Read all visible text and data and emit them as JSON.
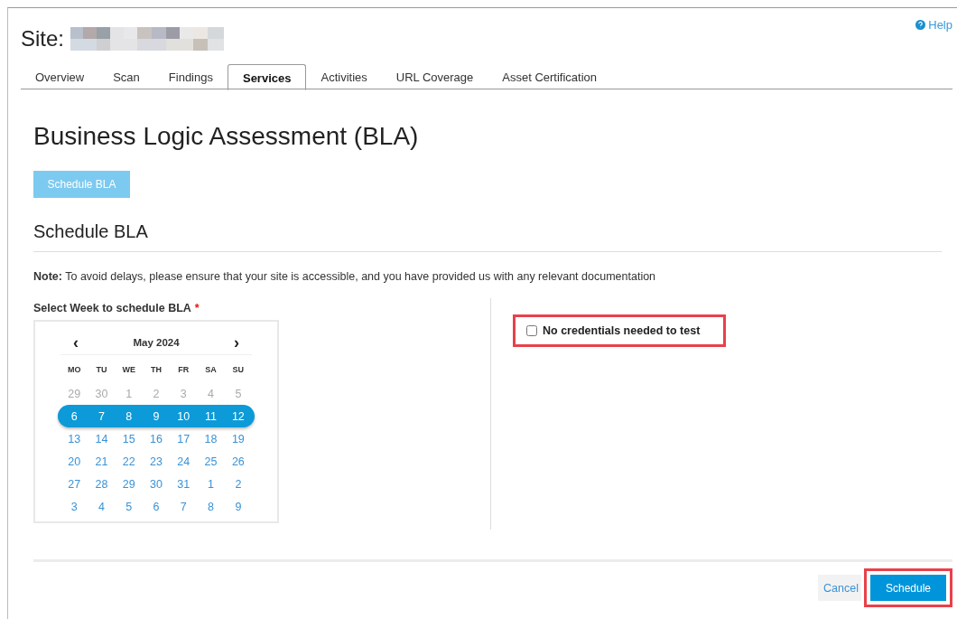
{
  "header": {
    "site_label": "Site:",
    "help": "Help"
  },
  "tabs": [
    {
      "label": "Overview",
      "selected": false
    },
    {
      "label": "Scan",
      "selected": false
    },
    {
      "label": "Findings",
      "selected": false
    },
    {
      "label": "Services",
      "selected": true
    },
    {
      "label": "Activities",
      "selected": false
    },
    {
      "label": "URL Coverage",
      "selected": false
    },
    {
      "label": "Asset Certification",
      "selected": false
    }
  ],
  "page_title": "Business Logic Assessment (BLA)",
  "schedule_bla_button": {
    "label": "Schedule BLA",
    "disabled": true
  },
  "section_title": "Schedule BLA",
  "note": "**Note:** To avoid delays, please ensure that your site is accessible, and you have provided us with any relevant documentation",
  "week_field": {
    "label": "Select Week to schedule BLA",
    "required_mark": "*"
  },
  "calendar": {
    "prev": "‹",
    "month": "May 2024",
    "next": "›",
    "weekdays": [
      "MO",
      "TU",
      "WE",
      "TH",
      "FR",
      "SA",
      "SU"
    ],
    "weeks": [
      {
        "selected": false,
        "days": [
          {
            "day": "29",
            "muted": true
          },
          {
            "day": "30",
            "muted": true
          },
          {
            "day": "1",
            "muted": true
          },
          {
            "day": "2",
            "muted": true
          },
          {
            "day": "3",
            "muted": true
          },
          {
            "day": "4",
            "muted": true
          },
          {
            "day": "5",
            "muted": true
          }
        ]
      },
      {
        "selected": true,
        "days": [
          {
            "day": "6",
            "muted": false
          },
          {
            "day": "7",
            "muted": false
          },
          {
            "day": "8",
            "muted": false
          },
          {
            "day": "9",
            "muted": false
          },
          {
            "day": "10",
            "muted": false
          },
          {
            "day": "11",
            "muted": false
          },
          {
            "day": "12",
            "muted": false
          }
        ]
      },
      {
        "selected": false,
        "days": [
          {
            "day": "13",
            "muted": false
          },
          {
            "day": "14",
            "muted": false
          },
          {
            "day": "15",
            "muted": false
          },
          {
            "day": "16",
            "muted": false
          },
          {
            "day": "17",
            "muted": false
          },
          {
            "day": "18",
            "muted": false
          },
          {
            "day": "19",
            "muted": false
          }
        ]
      },
      {
        "selected": false,
        "days": [
          {
            "day": "20",
            "muted": false
          },
          {
            "day": "21",
            "muted": false
          },
          {
            "day": "22",
            "muted": false
          },
          {
            "day": "23",
            "muted": false
          },
          {
            "day": "24",
            "muted": false
          },
          {
            "day": "25",
            "muted": false
          },
          {
            "day": "26",
            "muted": false
          }
        ]
      },
      {
        "selected": false,
        "days": [
          {
            "day": "27",
            "muted": false
          },
          {
            "day": "28",
            "muted": false
          },
          {
            "day": "29",
            "muted": false
          },
          {
            "day": "30",
            "muted": false
          },
          {
            "day": "31",
            "muted": false
          },
          {
            "day": "1",
            "muted": false
          },
          {
            "day": "2",
            "muted": false
          }
        ]
      },
      {
        "selected": false,
        "days": [
          {
            "day": "3",
            "muted": false
          },
          {
            "day": "4",
            "muted": false
          },
          {
            "day": "5",
            "muted": false
          },
          {
            "day": "6",
            "muted": false
          },
          {
            "day": "7",
            "muted": false
          },
          {
            "day": "8",
            "muted": false
          },
          {
            "day": "9",
            "muted": false
          }
        ]
      }
    ]
  },
  "credentials_checkbox": {
    "label": "No credentials needed to test",
    "checked": false,
    "highlighted": true
  },
  "footer": {
    "cancel": "Cancel",
    "schedule": {
      "label": "Schedule",
      "highlighted": true
    }
  }
}
